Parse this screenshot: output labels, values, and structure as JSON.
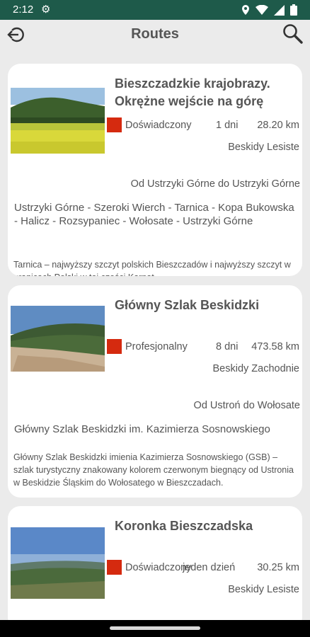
{
  "status_bar": {
    "time": "2:12"
  },
  "app_bar": {
    "title": "Routes"
  },
  "routes": [
    {
      "title": "Bieszczadzkie krajobrazy. Okrężne wejście na górę",
      "difficulty": "Doświadczony",
      "difficulty_color": "#d52a0f",
      "duration": "1 dni",
      "distance": "28.20 km",
      "region": "Beskidy Lesiste",
      "from_to": "Od Ustrzyki Górne do Ustrzyki Górne",
      "waypoints": "Ustrzyki Górne - Szeroki Wierch - Tarnica - Kopa Bukowska - Halicz - Rozsypaniec - Wołosate - Ustrzyki Górne",
      "description": "Tarnica – najwyższy szczyt polskich Bieszczadów i najwyższy szczyt w granicach Polski w tej części Karpat."
    },
    {
      "title": "Główny Szlak Beskidzki",
      "difficulty": "Profesjonalny",
      "difficulty_color": "#d52a0f",
      "duration": "8 dni",
      "distance": "473.58 km",
      "region": "Beskidy Zachodnie",
      "from_to": "Od Ustroń do Wołosate",
      "waypoints": "Główny Szlak Beskidzki im. Kazimierza Sosnowskiego",
      "description": "Główny Szlak Beskidzki imienia Kazimierza Sosnowskiego (GSB) – szlak turystyczny znakowany kolorem czerwonym biegnący od Ustronia w Beskidzie Śląskim do Wołosatego w Bieszczadach."
    },
    {
      "title": "Koronka Bieszczadska",
      "difficulty": "Doświadczony",
      "difficulty_color": "#d52a0f",
      "duration": "jeden dzień",
      "distance": "30.25 km",
      "region": "Beskidy Lesiste"
    }
  ]
}
